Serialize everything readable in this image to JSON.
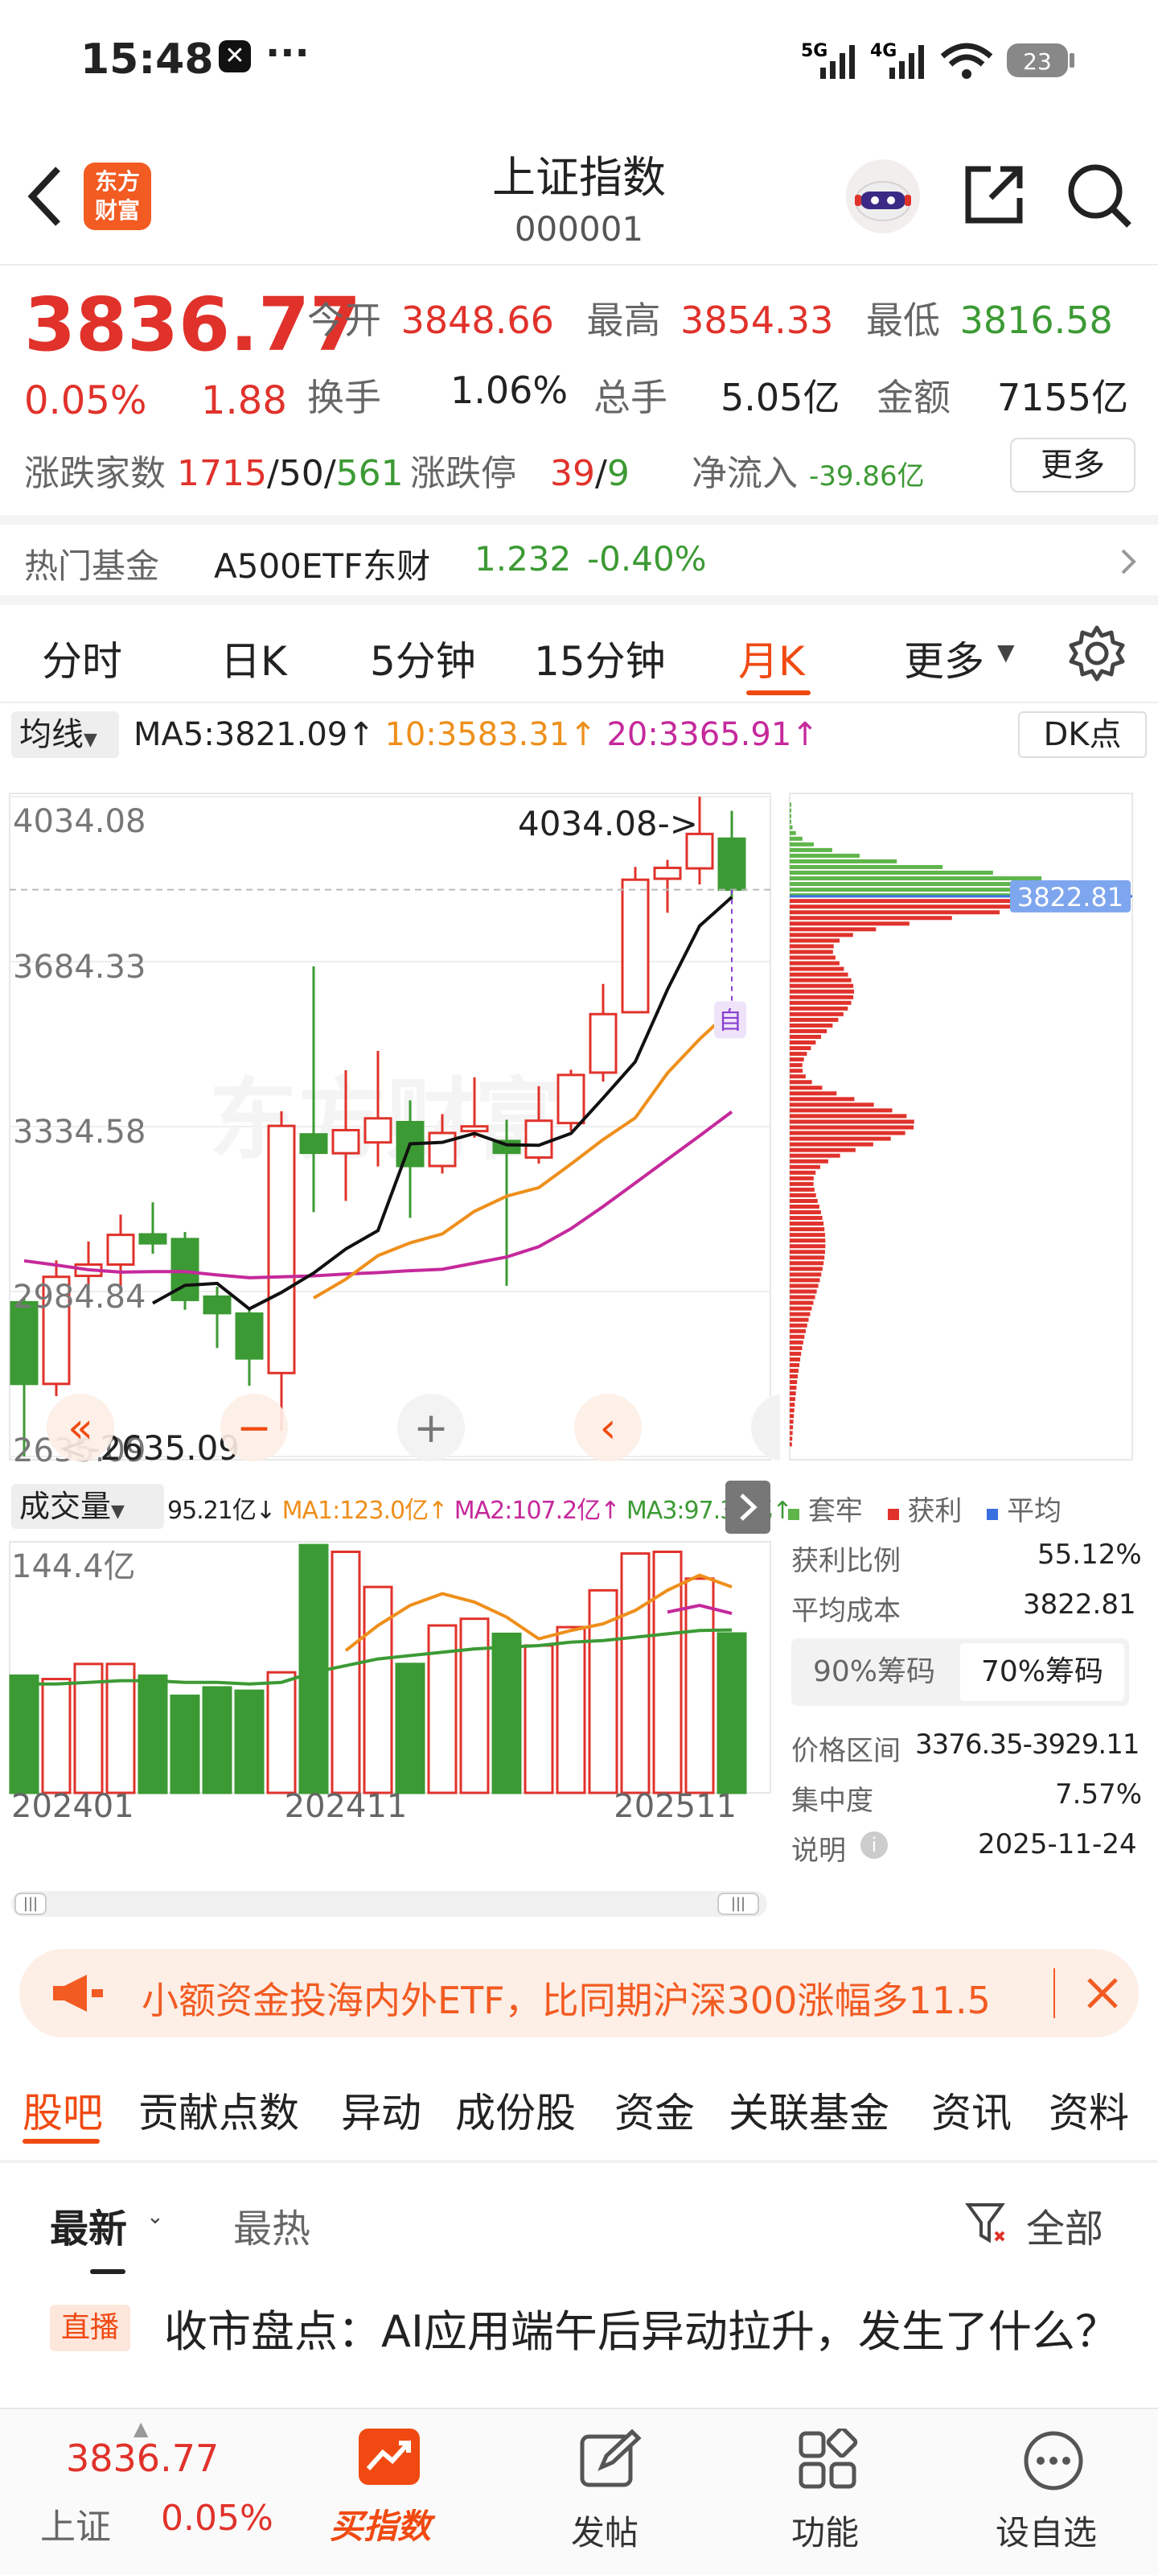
{
  "status_bar": {
    "time": "15:48",
    "dots": "···",
    "network1": "5G",
    "network2": "4G",
    "battery": "23"
  },
  "header": {
    "logo_text": "东方财富",
    "title": "上证指数",
    "code": "000001",
    "icons": [
      "back-arrow",
      "robot-avatar",
      "share-icon",
      "search-icon"
    ]
  },
  "quote": {
    "price": "3836.77",
    "change_pct": "0.05%",
    "change": "1.88",
    "open_label": "今开",
    "open": "3848.66",
    "high_label": "最高",
    "high": "3854.33",
    "low_label": "最低",
    "low": "3816.58",
    "turnover_label": "换手",
    "turnover": "1.06%",
    "volume_label": "总手",
    "volume": "5.05亿",
    "amount_label": "金额",
    "amount": "7155亿",
    "advdec_label": "涨跌家数",
    "adv": "1715",
    "flat": "50",
    "dec": "561",
    "limit_label": "涨跌停",
    "limit_up": "39",
    "limit_down": "9",
    "netflow_label": "净流入",
    "netflow": "-39.86亿",
    "more_button": "更多",
    "slash": "/"
  },
  "hot_fund": {
    "label": "热门基金",
    "name": "A500ETF东财",
    "price": "1.232",
    "change": "-0.40%"
  },
  "chart_tabs": {
    "items": [
      "分时",
      "日K",
      "5分钟",
      "15分钟",
      "月K",
      "更多"
    ],
    "selected": 4
  },
  "kline": {
    "ma_selector": "均线",
    "ma5": "MA5:3821.09↑",
    "ma10": "10:3583.31↑",
    "ma20": "20:3365.91↑",
    "dk_button": "DK点",
    "y_labels": [
      "4034.08",
      "3684.33",
      "3334.58",
      "2984.84",
      "2635.09"
    ],
    "max_annotation": "4034.08->",
    "min_annotation": "<-2635.09",
    "self_tag": "自",
    "cost_tag": "3822.81",
    "watermark": "东方财富"
  },
  "chart_data": [
    {
      "type": "candlestick",
      "title": "",
      "periods": [
        "2024-01",
        "2024-02",
        "2024-03",
        "2024-04",
        "2024-05",
        "2024-06",
        "2024-07",
        "2024-08",
        "2024-09",
        "2024-10",
        "2024-11",
        "2024-12",
        "2025-01",
        "2025-02",
        "2025-03",
        "2025-04",
        "2025-05",
        "2025-06",
        "2025-07",
        "2025-08",
        "2025-09",
        "2025-10",
        "2025-11"
      ],
      "open": [
        2962,
        2789,
        3018,
        3042,
        3106,
        3096,
        2974,
        2938,
        2812,
        3318,
        3278,
        3301,
        3344,
        3251,
        3325,
        3304,
        3269,
        3342,
        3449,
        3577,
        3860,
        3882,
        3945
      ],
      "close": [
        2789,
        3016,
        3042,
        3105,
        3087,
        2967,
        2939,
        2843,
        3336,
        3279,
        3327,
        3352,
        3251,
        3321,
        3335,
        3279,
        3347,
        3444,
        3573,
        3858,
        3883,
        3955,
        3837
      ],
      "high": [
        2972,
        3051,
        3091,
        3148,
        3174,
        3111,
        2995,
        2948,
        3367,
        3674,
        3454,
        3495,
        3390,
        3361,
        3439,
        3349,
        3420,
        3455,
        3637,
        3885,
        3900,
        4034,
        4004
      ],
      "low": [
        2635,
        2763,
        2995,
        2986,
        3065,
        2946,
        2865,
        2785,
        2690,
        3153,
        3177,
        3250,
        3141,
        3235,
        3311,
        2997,
        3256,
        3325,
        3430,
        3575,
        3788,
        3848,
        3816
      ],
      "ma5": [
        null,
        null,
        null,
        null,
        2960,
        2998,
        3002,
        2948,
        2983,
        3024,
        3075,
        3114,
        3298,
        3301,
        3320,
        3296,
        3295,
        3320,
        3395,
        3472,
        3625,
        3760,
        3821
      ],
      "ma10": [
        null,
        null,
        null,
        null,
        null,
        null,
        null,
        null,
        null,
        2971,
        3011,
        3061,
        3088,
        3107,
        3155,
        3187,
        3205,
        3255,
        3307,
        3353,
        3448,
        3520,
        3583
      ],
      "ma20": [
        3050,
        3041,
        3031,
        3026,
        3027,
        3027,
        3020,
        3014,
        3016,
        3018,
        3022,
        3025,
        3029,
        3032,
        3045,
        3058,
        3080,
        3118,
        3165,
        3215,
        3265,
        3315,
        3366
      ],
      "ylim": [
        2635.09,
        4034.08
      ],
      "y_ticks": [
        4034.08,
        3684.33,
        3334.58,
        2984.84,
        2635.09
      ]
    },
    {
      "type": "bar",
      "title": "成交量",
      "periods": [
        "2024-01",
        "2024-02",
        "2024-03",
        "2024-04",
        "2024-05",
        "2024-06",
        "2024-07",
        "2024-08",
        "2024-09",
        "2024-10",
        "2024-11",
        "2024-12",
        "2025-01",
        "2025-02",
        "2025-03",
        "2025-04",
        "2025-05",
        "2025-06",
        "2025-07",
        "2025-08",
        "2025-09",
        "2025-10",
        "2025-11"
      ],
      "values": [
        70,
        68,
        77,
        77,
        70,
        58,
        63,
        61,
        72,
        148,
        144,
        123,
        77,
        100,
        104,
        95,
        88,
        99,
        121,
        143,
        144,
        128,
        95.21
      ],
      "direction": [
        "down",
        "up",
        "up",
        "up",
        "down",
        "down",
        "down",
        "down",
        "up",
        "down",
        "up",
        "up",
        "down",
        "up",
        "up",
        "down",
        "up",
        "up",
        "up",
        "up",
        "up",
        "up",
        "down"
      ],
      "ma1": [
        null,
        null,
        null,
        null,
        null,
        null,
        null,
        null,
        null,
        null,
        85,
        100,
        112,
        119,
        114,
        105,
        92,
        97,
        101,
        109,
        121,
        130,
        123
      ],
      "ma2": [
        null,
        null,
        null,
        null,
        null,
        null,
        null,
        null,
        null,
        null,
        null,
        null,
        null,
        null,
        null,
        null,
        null,
        null,
        null,
        null,
        108,
        112,
        107.2
      ],
      "ma3": [
        65,
        65,
        66,
        67,
        67,
        66,
        66,
        65,
        66,
        72,
        76,
        80,
        82,
        84,
        86,
        87,
        88,
        90,
        91,
        93,
        95,
        97,
        97.31
      ],
      "ylim": [
        0,
        150
      ],
      "y_label_top": "144.4亿",
      "legend": {
        "vol": "95.21亿↓",
        "ma1": "MA1:123.0亿↑",
        "ma2": "MA2:107.2亿↑",
        "ma3": "MA3:97.31亿↑"
      },
      "x_labels": [
        "202401",
        "202411",
        "202511"
      ],
      "selector": "成交量"
    },
    {
      "type": "bar",
      "title": "",
      "orientation": "horizontal",
      "price_range": [
        2635.09,
        4034.08
      ],
      "split_price": 3822.81,
      "legend": [
        "套牢",
        "获利",
        "平均"
      ]
    }
  ],
  "chip_panel": {
    "legend_trapped": "套牢",
    "legend_profit": "获利",
    "legend_avg": "平均",
    "profit_ratio_label": "获利比例",
    "profit_ratio": "55.12%",
    "avg_cost_label": "平均成本",
    "avg_cost": "3822.81",
    "tab90": "90%筹码",
    "tab70": "70%筹码",
    "range_label": "价格区间",
    "range": "3376.35-3929.11",
    "concentration_label": "集中度",
    "concentration": "7.57%",
    "note_label": "说明",
    "note_date": "2025-11-24"
  },
  "banner": {
    "text": "小额资金投海内外ETF，比同期沪深300涨幅多11.5"
  },
  "content_tabs": {
    "items": [
      "股吧",
      "贡献点数",
      "异动",
      "成份股",
      "资金",
      "关联基金",
      "资讯",
      "资料"
    ],
    "selected": 0
  },
  "feed": {
    "sort_new": "最新",
    "sort_hot": "最热",
    "filter": "全部",
    "item_tag": "直播",
    "item_title": "收市盘点：AI应用端午后异动拉升，发生了什么？"
  },
  "bottom_bar": {
    "price": "3836.77",
    "name": "上证",
    "change": "0.05%",
    "items": [
      "买指数",
      "发帖",
      "功能",
      "设自选"
    ]
  },
  "colors": {
    "up": "#e0322b",
    "down": "#3c9a34",
    "accent": "#f04a12",
    "ma5": "#111111",
    "ma10": "#ee8f1b",
    "ma20": "#c5299b"
  }
}
